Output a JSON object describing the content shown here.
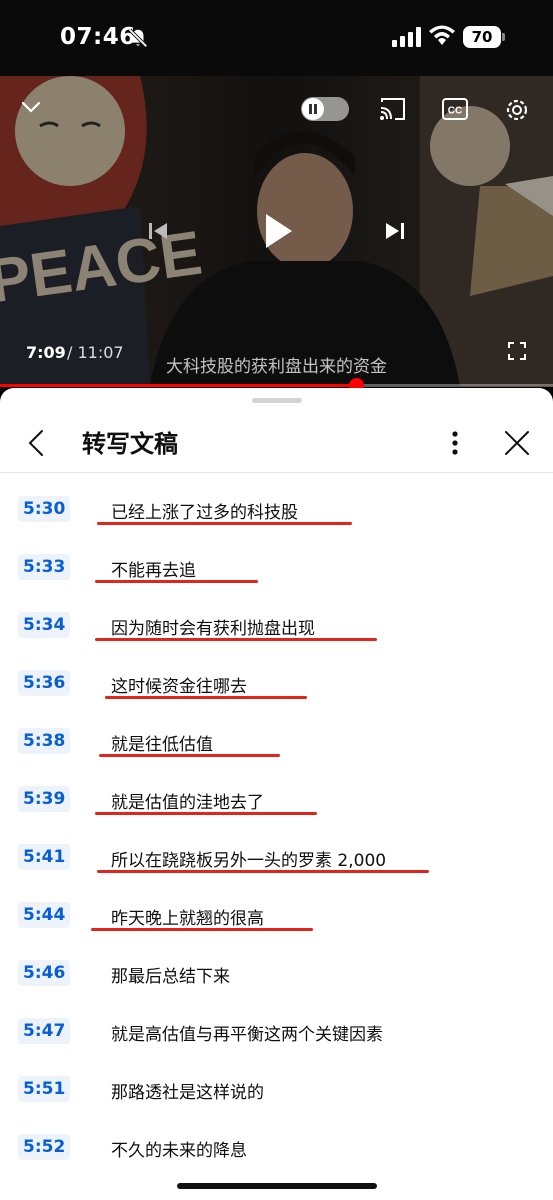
{
  "status_bar": {
    "time": "07:46",
    "battery": "70"
  },
  "player": {
    "current_time": "7:09",
    "total_time": "/ 11:07",
    "caption": "大科技股的获利盘出来的资金",
    "progress": 0.643
  },
  "transcript": {
    "title": "转写文稿",
    "rows": [
      {
        "time": "5:30",
        "text": "已经上涨了过多的科技股",
        "underlined": true
      },
      {
        "time": "5:33",
        "text": "不能再去追",
        "underlined": true
      },
      {
        "time": "5:34",
        "text": "因为随时会有获利抛盘出现",
        "underlined": true
      },
      {
        "time": "5:36",
        "text": "这时候资金往哪去",
        "underlined": true
      },
      {
        "time": "5:38",
        "text": "就是往低估值",
        "underlined": true
      },
      {
        "time": "5:39",
        "text": "就是估值的洼地去了",
        "underlined": true
      },
      {
        "time": "5:41",
        "text": "所以在跷跷板另外一头的罗素 2,000",
        "underlined": true
      },
      {
        "time": "5:44",
        "text": "昨天晚上就翘的很高",
        "underlined": true
      },
      {
        "time": "5:46",
        "text": "那最后总结下来",
        "underlined": false
      },
      {
        "time": "5:47",
        "text": "就是高估值与再平衡这两个关键因素",
        "underlined": false
      },
      {
        "time": "5:51",
        "text": "那路透社是这样说的",
        "underlined": false
      },
      {
        "time": "5:52",
        "text": "不久的未来的降息",
        "underlined": false
      }
    ]
  },
  "colors": {
    "accent": "#ff0000",
    "timestamp": "#065fd4",
    "annotation": "#e0251c"
  }
}
